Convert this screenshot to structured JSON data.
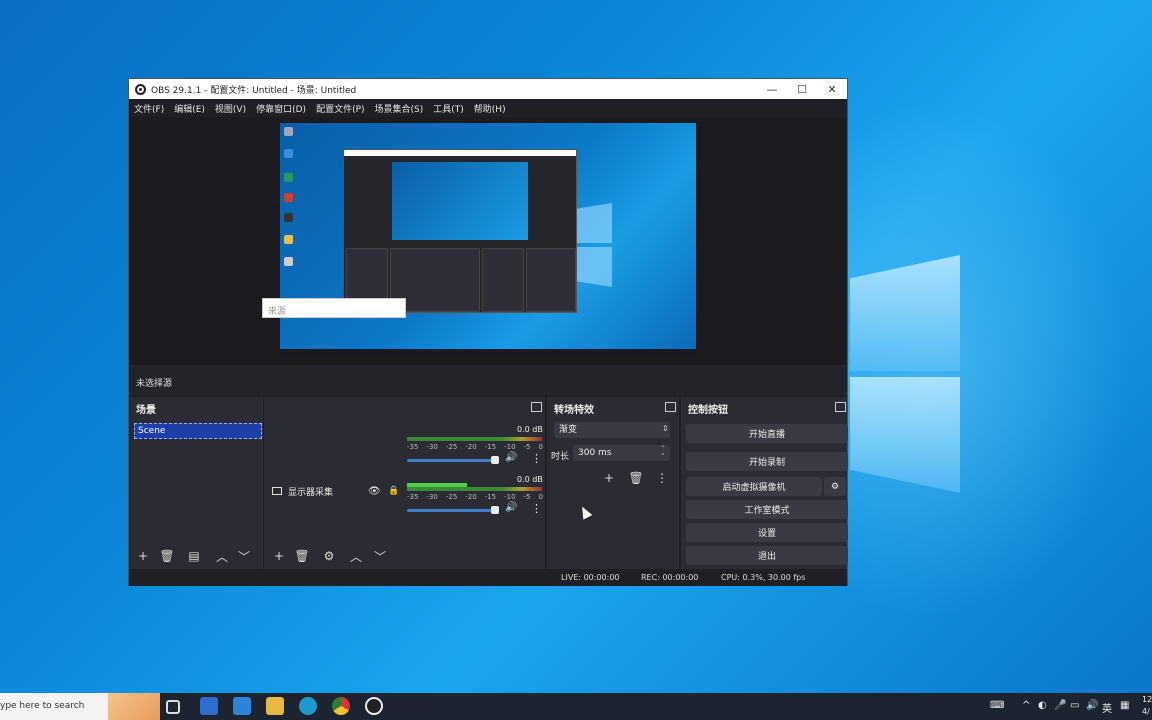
{
  "window": {
    "title": "OBS 29.1.1 - 配置文件: Untitled - 场景: Untitled",
    "minimize_glyph": "—",
    "maximize_glyph": "☐",
    "close_glyph": "✕"
  },
  "menu": [
    "文件(F)",
    "编辑(E)",
    "视图(V)",
    "停靠窗口(D)",
    "配置文件(P)",
    "场景集合(S)",
    "工具(T)",
    "帮助(H)"
  ],
  "source_bar": {
    "no_source": "未选择源",
    "popup_label": "来源"
  },
  "scenes": {
    "header": "场景",
    "items": [
      "Scene"
    ]
  },
  "sources": {
    "items": [
      {
        "label": "显示器采集"
      }
    ]
  },
  "mixer": {
    "tracks": [
      {
        "db": "0.0 dB",
        "ticks": [
          "-35",
          "-30",
          "-25",
          "-20",
          "-15",
          "-10",
          "-5",
          "0"
        ],
        "volume": 1.0
      },
      {
        "db": "0.0 dB",
        "ticks": [
          "-35",
          "-30",
          "-25",
          "-20",
          "-15",
          "-10",
          "-5",
          "0"
        ],
        "volume": 1.0
      }
    ]
  },
  "transitions": {
    "header": "转场特效",
    "selected": "渐变",
    "duration_label": "时长",
    "duration_value": "300 ms"
  },
  "controls": {
    "header": "控制按钮",
    "buttons": [
      "开始直播",
      "开始录制",
      "启动虚拟摄像机",
      "工作室模式",
      "设置",
      "退出"
    ]
  },
  "status": {
    "live": "LIVE: 00:00:00",
    "rec": "REC: 00:00:00",
    "cpu": "CPU: 0.3%, 30.00 fps"
  },
  "taskbar": {
    "search_placeholder": "ype here to search",
    "tray_lang": "英",
    "clock_top": "12",
    "clock_bottom": "4/"
  },
  "colors": {
    "obs_bg": "#1f1f25",
    "dock_bg": "#2b2b33",
    "selected_scene": "#1e3fa8",
    "desktop": "#0b86d8"
  }
}
